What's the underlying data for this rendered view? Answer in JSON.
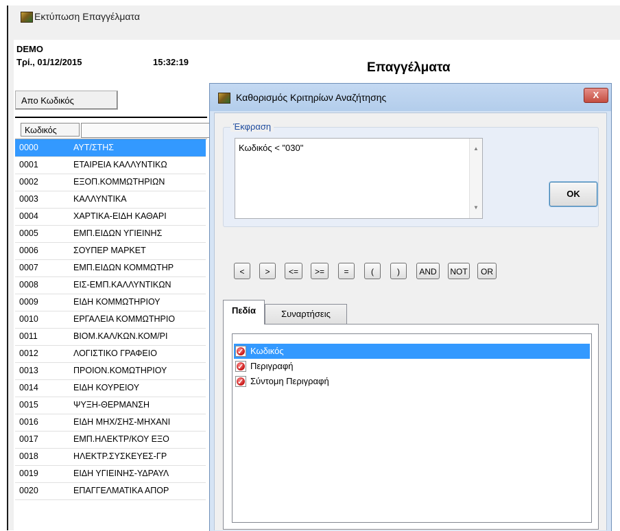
{
  "window": {
    "title": "Εκτύπωση Επαγγέλματα"
  },
  "report": {
    "company": "DEMO",
    "date": "Τρί., 01/12/2015",
    "time": "15:32:19",
    "title": "Επαγγέλματα",
    "sort_button": "Απο Κωδικός",
    "column_code": "Κωδικός",
    "rows": [
      {
        "code": "0000",
        "desc": "ΑΥΤ/ΣΤΗΣ"
      },
      {
        "code": "0001",
        "desc": "ΕΤΑΙΡΕΙΑ ΚΑΛΛΥΝΤΙΚΩ"
      },
      {
        "code": "0002",
        "desc": "ΕΞΟΠ.ΚΟΜΜΩΤΗΡΙΩΝ"
      },
      {
        "code": "0003",
        "desc": "ΚΑΛΛΥΝΤΙΚΑ"
      },
      {
        "code": "0004",
        "desc": "ΧΑΡΤΙΚΑ-ΕΙΔΗ ΚΑΘΑΡΙ"
      },
      {
        "code": "0005",
        "desc": "ΕΜΠ.ΕΙΔΩΝ ΥΓΙΕΙΝΗΣ"
      },
      {
        "code": "0006",
        "desc": "ΣΟΥΠΕΡ ΜΑΡΚΕΤ"
      },
      {
        "code": "0007",
        "desc": "ΕΜΠ.ΕΙΔΩΝ ΚΟΜΜΩΤΗΡ"
      },
      {
        "code": "0008",
        "desc": "ΕΙΣ-ΕΜΠ.ΚΑΛΛΥΝΤΙΚΩΝ"
      },
      {
        "code": "0009",
        "desc": "ΕΙΔΗ ΚΟΜΜΩΤΗΡΙΟΥ"
      },
      {
        "code": "0010",
        "desc": "ΕΡΓΑΛΕΙΑ ΚΟΜΜΩΤΗΡΙΟ"
      },
      {
        "code": "0011",
        "desc": "ΒΙΟΜ.ΚΑΛ/ΚΩΝ.ΚΟΜ/ΡΙ"
      },
      {
        "code": "0012",
        "desc": "ΛΟΓΙΣΤΙΚΟ ΓΡΑΦΕΙΟ"
      },
      {
        "code": "0013",
        "desc": "ΠΡΟΙΟΝ.ΚΟΜΩΤΗΡΙΟΥ"
      },
      {
        "code": "0014",
        "desc": "ΕΙΔΗ ΚΟΥΡΕΙΟΥ"
      },
      {
        "code": "0015",
        "desc": "ΨΥΞΗ-ΘΕΡΜΑΝΣΗ"
      },
      {
        "code": "0016",
        "desc": "ΕΙΔΗ ΜΗΧ/ΣΗΣ-ΜΗΧΑΝΙ"
      },
      {
        "code": "0017",
        "desc": "ΕΜΠ.ΗΛΕΚΤΡ/ΚΟΥ ΕΞΟ"
      },
      {
        "code": "0018",
        "desc": "ΗΛΕΚΤΡ.ΣΥΣΚΕΥΕΣ-ΓΡ"
      },
      {
        "code": "0019",
        "desc": "ΕΙΔΗ ΥΓΙΕΙΝΗΣ-ΥΔΡΑΥΛ"
      },
      {
        "code": "0020",
        "desc": "ΕΠΑΓΓΕΛΜΑΤΙΚΑ ΑΠΟΡ"
      }
    ]
  },
  "dialog": {
    "title": "Καθορισμός Κριτηρίων Αναζήτησης",
    "close": "X",
    "expression_label": "Έκφραση",
    "expression": "Κωδικός < \"030\"",
    "ok": "OK",
    "operators": [
      "<",
      ">",
      "<=",
      ">=",
      "=",
      "(",
      ")",
      "AND",
      "NOT",
      "OR"
    ],
    "tabs": [
      "Πεδία",
      "Συναρτήσεις"
    ],
    "fields": [
      "Κωδικός",
      "Περιγραφή",
      "Σύντομη Περιγραφή"
    ]
  },
  "colors": {
    "selection": "#3399ff",
    "dialog_frame": "#d6e4f5",
    "close_button": "#c44d40"
  },
  "icons": [
    "app-icon",
    "dialog-app-icon",
    "checked-icon",
    "scroll-up-icon",
    "scroll-down-icon"
  ]
}
